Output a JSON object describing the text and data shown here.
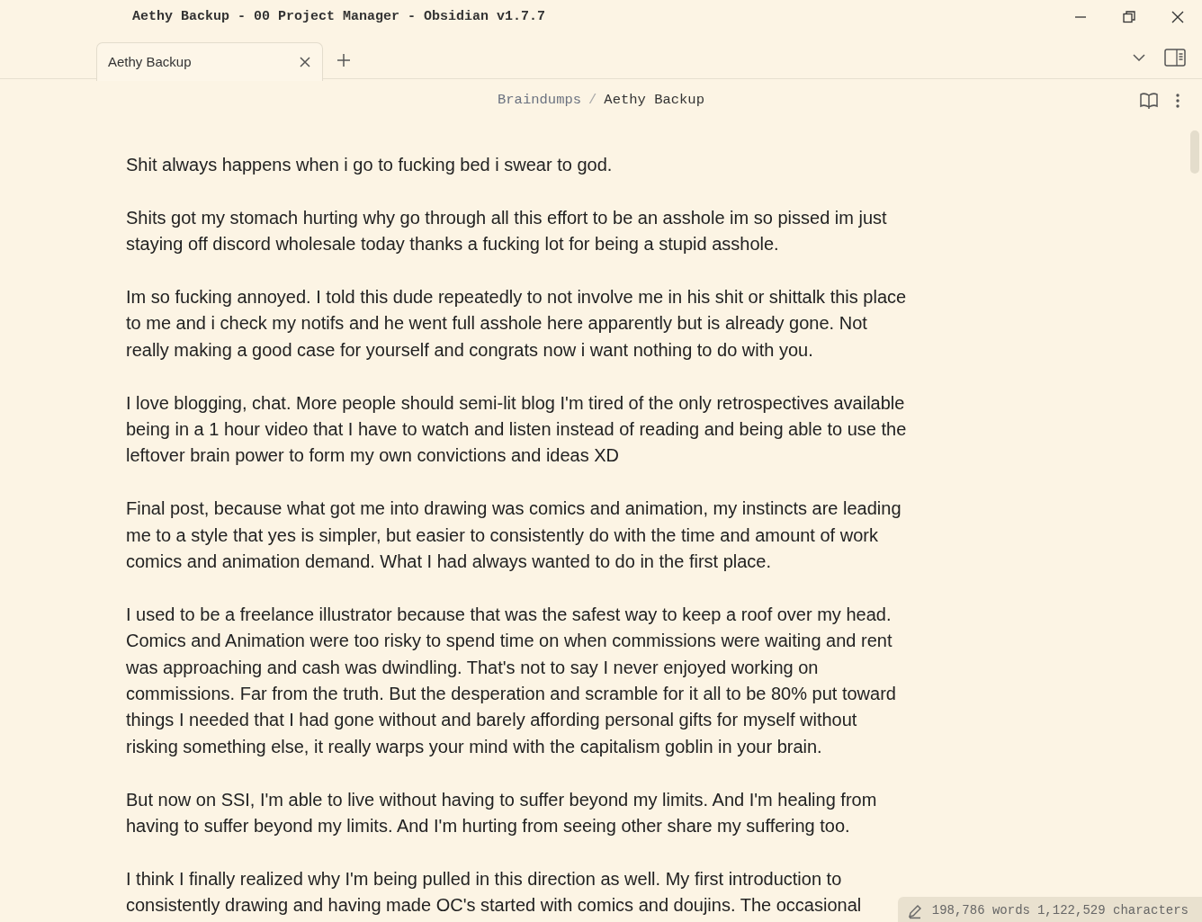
{
  "window": {
    "title": "Aethy Backup - 00 Project Manager - Obsidian v1.7.7"
  },
  "tabs": [
    {
      "label": "Aethy Backup",
      "selected": true
    }
  ],
  "breadcrumb": {
    "items": [
      "Braindumps",
      "Aethy Backup"
    ],
    "separator": "/"
  },
  "paragraphs": [
    "Shit always happens when i go to fucking bed i swear to god.",
    "Shits got my stomach hurting why go through all this effort to be an asshole im so pissed im just staying off discord wholesale today thanks a fucking lot for being a stupid asshole.",
    "Im so fucking annoyed. I told this dude repeatedly to not involve me in his shit or shittalk this place to me and i check my notifs and he went full asshole here apparently but is already gone. Not really making a good case for yourself and congrats now i want nothing to do with you.",
    "I love blogging, chat. More people should semi-lit blog I'm tired of the only retrospectives available being in a 1 hour video that I have to watch and listen instead of reading and being able to use the leftover brain power to form my own convictions and ideas XD",
    "Final post, because what got me into drawing was comics and animation, my instincts are leading me to a style that yes is simpler, but easier to consistently do with the time and amount of work comics and animation demand. What I had always wanted to do in the first place.",
    "I used to be a freelance illustrator because that was the safest way to keep a roof over my head. Comics and Animation were too risky to spend time on when commissions were waiting and rent was approaching and cash was dwindling. That's not to say I never enjoyed working on commissions. Far from the truth. But the desperation and scramble for it all to be 80% put toward things I needed that I had gone without and barely affording personal gifts for myself without risking something else, it really warps your mind with the capitalism goblin in your brain.",
    "But now on SSI, I'm able to live without having to suffer beyond my limits. And I'm healing from having to suffer beyond my limits. And I'm hurting from seeing other share my suffering too.",
    "I think I finally realized why I'm being pulled in this direction as well. My first introduction to consistently drawing and having made OC's started with comics and doujins. The occasional"
  ],
  "status_bar": {
    "words": "198,786 words",
    "characters": "1,122,529 characters"
  }
}
